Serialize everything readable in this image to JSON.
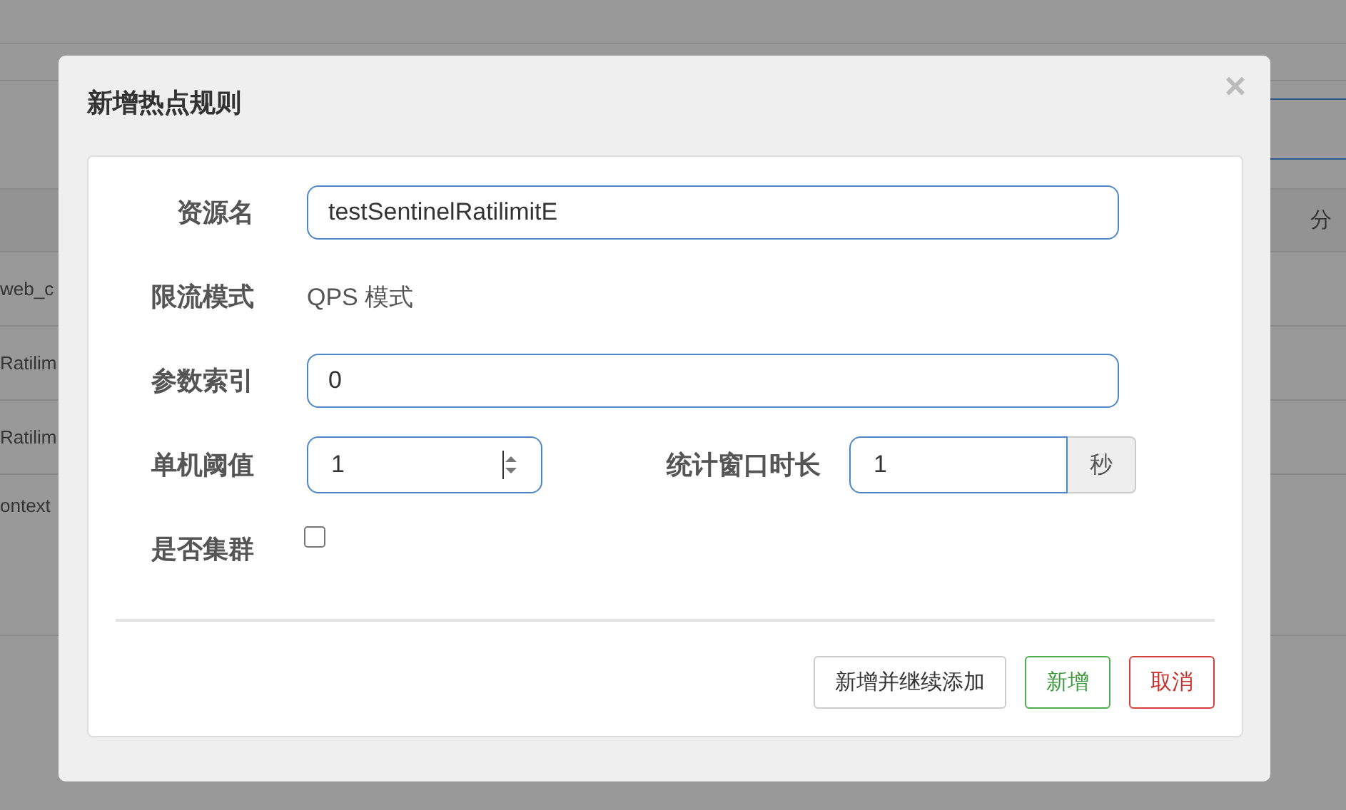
{
  "background_table": {
    "header": "分",
    "rows": [
      {
        "cell": "web_c"
      },
      {
        "cell": "Ratilim"
      },
      {
        "cell": "Ratilim"
      },
      {
        "cell": "ontext"
      }
    ]
  },
  "dialog": {
    "title": "新增热点规则",
    "close": "×",
    "fields": [
      {
        "kind": "text",
        "label": "资源名",
        "value": "testSentinelRatilimitE"
      },
      {
        "kind": "static",
        "label": "限流模式",
        "value": "QPS 模式"
      },
      {
        "kind": "text",
        "label": "参数索引",
        "value": "0"
      },
      {
        "kind": "pair",
        "label": "单机阈值",
        "value": "1",
        "second_label": "统计窗口时长",
        "second_value": "1",
        "unit": "秒"
      },
      {
        "kind": "checkbox",
        "label": "是否集群",
        "checked": false
      }
    ],
    "buttons": [
      {
        "label": "新增并继续添加",
        "kind": "default"
      },
      {
        "label": "新增",
        "kind": "success"
      },
      {
        "label": "取消",
        "kind": "danger"
      }
    ]
  }
}
